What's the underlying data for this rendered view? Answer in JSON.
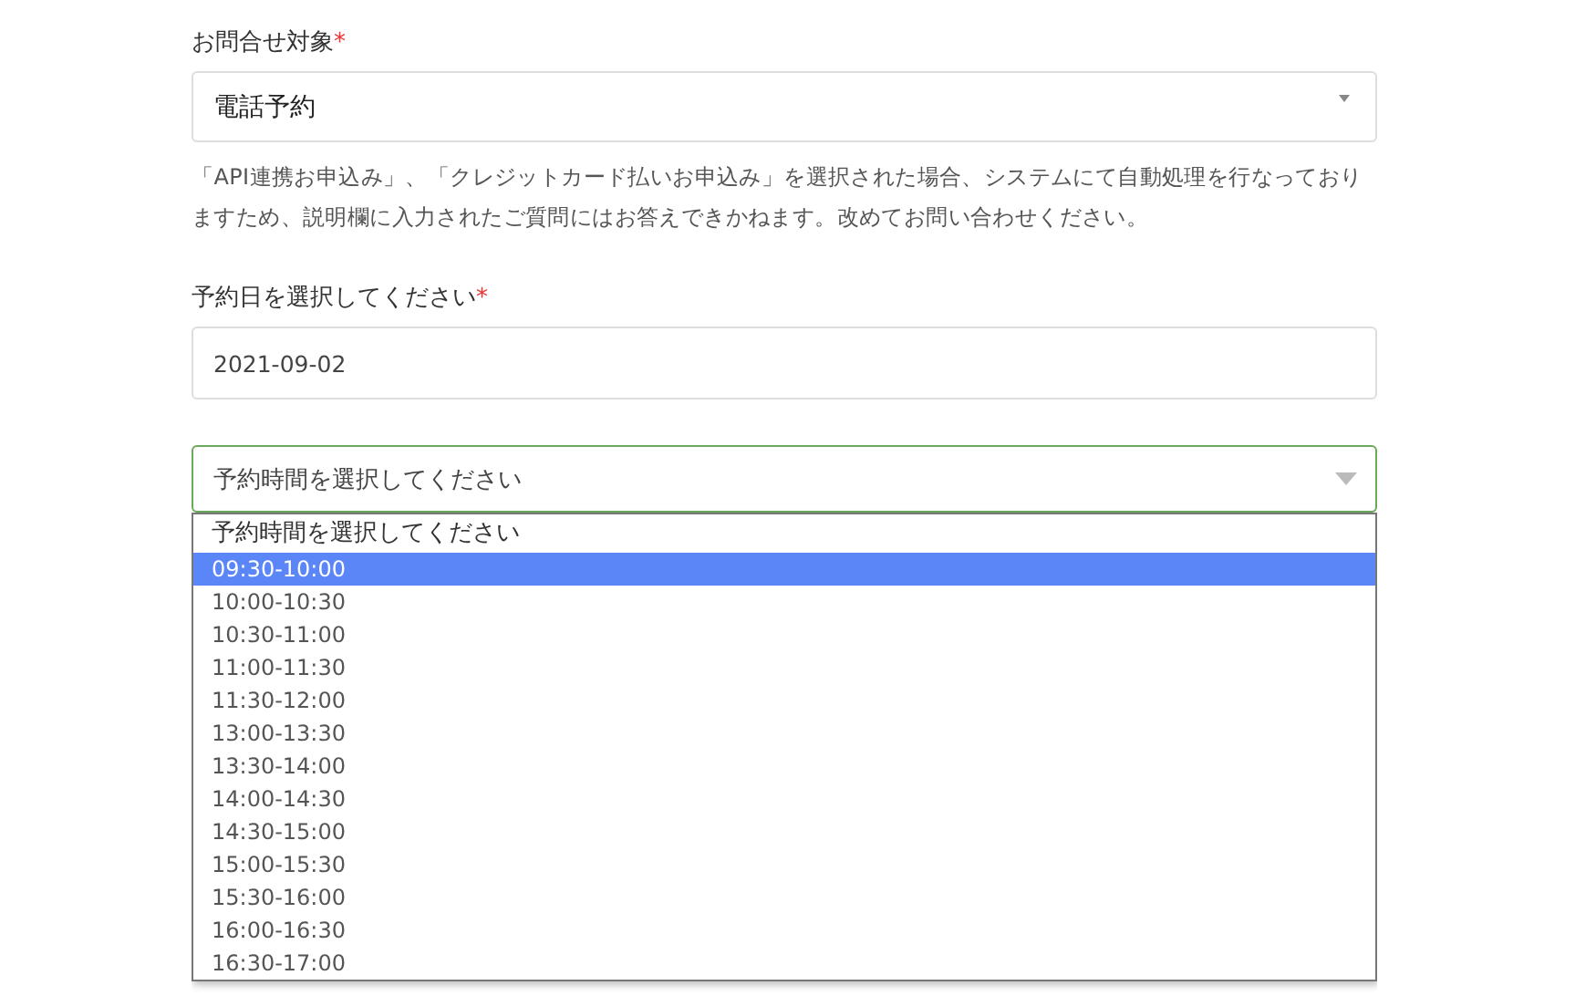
{
  "inquiry": {
    "label": "お問合せ対象",
    "required_mark": "*",
    "value": "電話予約",
    "note": "「API連携お申込み」、「クレジットカード払いお申込み」を選択された場合、システムにて自動処理を行なっておりますため、説明欄に入力されたご質問にはお答えできかねます。改めてお問い合わせください。"
  },
  "date": {
    "label": "予約日を選択してください",
    "required_mark": "*",
    "value": "2021-09-02"
  },
  "time": {
    "placeholder": "予約時間を選択してください",
    "expanded": true,
    "options": [
      {
        "label": "予約時間を選択してください",
        "selected": false
      },
      {
        "label": "09:30-10:00",
        "selected": true
      },
      {
        "label": "10:00-10:30",
        "selected": false
      },
      {
        "label": "10:30-11:00",
        "selected": false
      },
      {
        "label": "11:00-11:30",
        "selected": false
      },
      {
        "label": "11:30-12:00",
        "selected": false
      },
      {
        "label": "13:00-13:30",
        "selected": false
      },
      {
        "label": "13:30-14:00",
        "selected": false
      },
      {
        "label": "14:00-14:30",
        "selected": false
      },
      {
        "label": "14:30-15:00",
        "selected": false
      },
      {
        "label": "15:00-15:30",
        "selected": false
      },
      {
        "label": "15:30-16:00",
        "selected": false
      },
      {
        "label": "16:00-16:30",
        "selected": false
      },
      {
        "label": "16:30-17:00",
        "selected": false
      }
    ]
  }
}
